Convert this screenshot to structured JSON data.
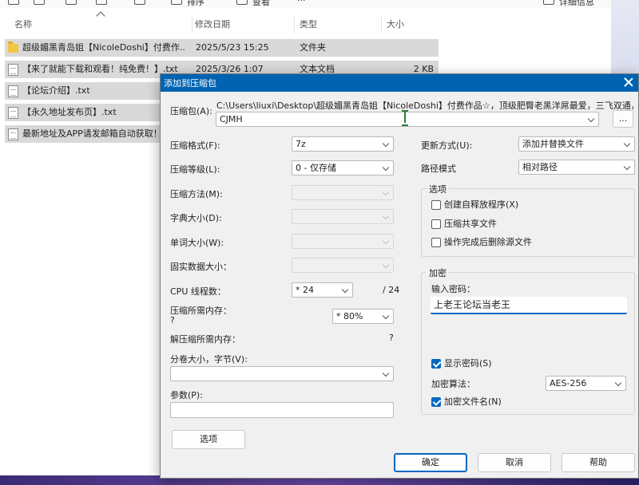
{
  "explorer": {
    "toolbar": {
      "sort_label": "排序",
      "view_label": "查看",
      "more_label": "···",
      "details_label": "详细信息"
    },
    "columns": [
      "名称",
      "修改日期",
      "类型",
      "大小"
    ],
    "files": [
      {
        "icon": "folder-icon",
        "name": "超级媚黑青岛姐【NicoleDoshi】付费作...",
        "date": "2025/5/23 15:25",
        "type": "文件夹",
        "size": ""
      },
      {
        "icon": "text-file-icon",
        "name": "【来了就能下载和观看！纯免费！】.txt",
        "date": "2025/3/26 1:07",
        "type": "文本文档",
        "size": "2 KB"
      },
      {
        "icon": "text-file-icon",
        "name": "【论坛介绍】.txt",
        "date": "",
        "type": "",
        "size": ""
      },
      {
        "icon": "text-file-icon",
        "name": "【永久地址发布页】.txt",
        "date": "",
        "type": "",
        "size": ""
      },
      {
        "icon": "text-file-icon",
        "name": "最新地址及APP请发邮箱自动获取！",
        "date": "",
        "type": "",
        "size": ""
      }
    ]
  },
  "dialog": {
    "title": "添加到压缩包",
    "archive": {
      "label": "压缩包(A):",
      "path": "C:\\Users\\liuxi\\Desktop\\超级媚黑青岛姐【NicoleDoshi】付费作品☆，顶级肥臀老黑洋屌最爱，三飞双通，激情四",
      "value": "CJMH",
      "browse_label": "..."
    },
    "left": {
      "format": {
        "label": "压缩格式(F):",
        "value": "7z"
      },
      "level": {
        "label": "压缩等级(L):",
        "value": "0 - 仅存储"
      },
      "method": {
        "label": "压缩方法(M):",
        "value": ""
      },
      "dict_size": {
        "label": "字典大小(D):",
        "value": ""
      },
      "word_size": {
        "label": "单词大小(W):",
        "value": ""
      },
      "solid_size": {
        "label": "固实数据大小：",
        "value": ""
      },
      "threads": {
        "label": "CPU 线程数：",
        "value": "* 24",
        "max": "/ 24"
      },
      "mem_compress": {
        "label": "压缩所需内存：",
        "question": "?",
        "value": "* 80%"
      },
      "mem_decompress": {
        "label": "解压缩所需内存：",
        "value": "?"
      },
      "volume": {
        "label": "分卷大小，字节(V):",
        "value": ""
      },
      "params": {
        "label": "参数(P):",
        "value": ""
      },
      "options_button": "选项"
    },
    "right": {
      "update_mode": {
        "label": "更新方式(U):",
        "value": "添加并替换文件"
      },
      "path_mode": {
        "label": "路径模式",
        "value": "相对路径"
      },
      "options": {
        "title": "选项",
        "sfx": {
          "label": "创建自释放程序(X)",
          "checked": false
        },
        "shared": {
          "label": "压缩共享文件",
          "checked": false
        },
        "delete_after": {
          "label": "操作完成后删除源文件",
          "checked": false
        }
      },
      "encryption": {
        "title": "加密",
        "password_label": "输入密码：",
        "password_value": "上老王论坛当老王",
        "show_password": {
          "label": "显示密码(S)",
          "checked": true
        },
        "method_label": "加密算法：",
        "method_value": "AES-256",
        "encrypt_names": {
          "label": "加密文件名(N)",
          "checked": true
        }
      }
    },
    "buttons": {
      "ok": "确定",
      "cancel": "取消",
      "help": "帮助"
    }
  },
  "colors": {
    "titlebar": "#0063b1",
    "checkbox_checked": "#0067c0",
    "file_row_selected": "#d9d9d9"
  }
}
